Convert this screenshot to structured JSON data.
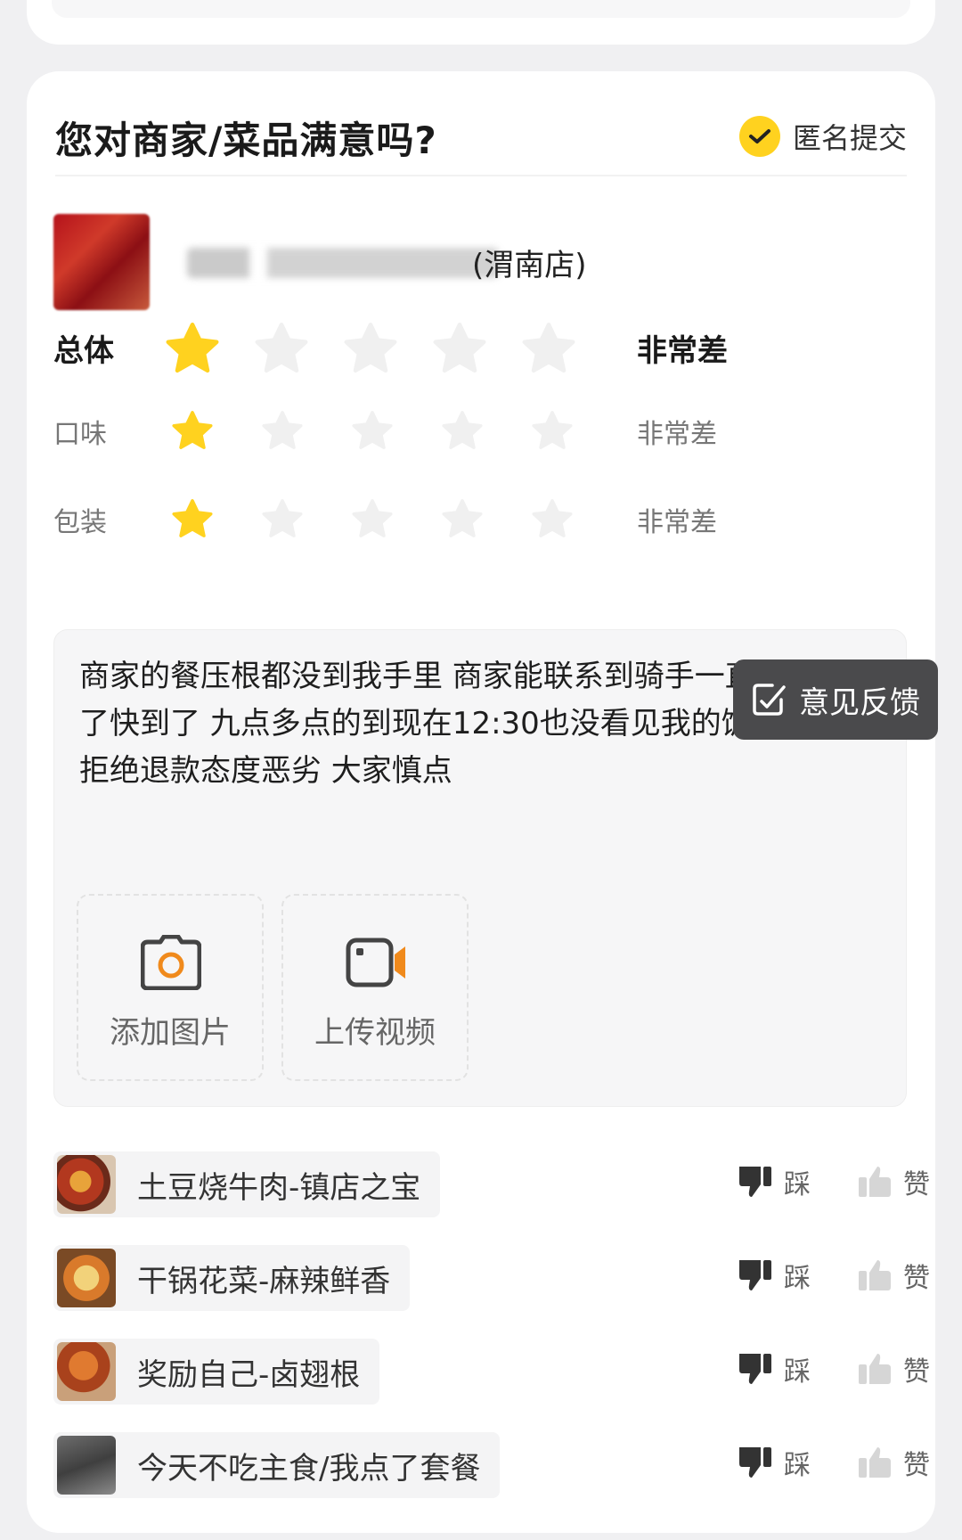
{
  "header": {
    "title": "您对商家/菜品满意吗?",
    "anonymous_label": "匿名提交",
    "anonymous_checked": true
  },
  "shop": {
    "name_suffix": "(渭南店)"
  },
  "ratings": [
    {
      "label": "总体",
      "stars": 1,
      "max": 5,
      "text": "非常差"
    },
    {
      "label": "口味",
      "stars": 1,
      "max": 5,
      "text": "非常差"
    },
    {
      "label": "包装",
      "stars": 1,
      "max": 5,
      "text": "非常差"
    }
  ],
  "feedback_button": {
    "label": "意见反馈"
  },
  "comment": {
    "text": "商家的餐压根都没到我手里 商家能联系到骑手一直说快到了快到了 九点多点的到现在12:30也没看见我的饭 商家还拒绝退款态度恶劣 大家慎点"
  },
  "uploads": {
    "photo_label": "添加图片",
    "video_label": "上传视频"
  },
  "dishes": [
    {
      "name": "土豆烧牛肉-镇店之宝",
      "dislike": "踩",
      "like": "赞"
    },
    {
      "name": "干锅花菜-麻辣鲜香",
      "dislike": "踩",
      "like": "赞"
    },
    {
      "name": "奖励自己-卤翅根",
      "dislike": "踩",
      "like": "赞"
    },
    {
      "name": "今天不吃主食/我点了套餐",
      "dislike": "踩",
      "like": "赞"
    }
  ],
  "colors": {
    "accent": "#ffd21f",
    "star_active": "#ffd21f",
    "star_inactive": "#f0f0f0",
    "orange": "#f08a1c"
  }
}
